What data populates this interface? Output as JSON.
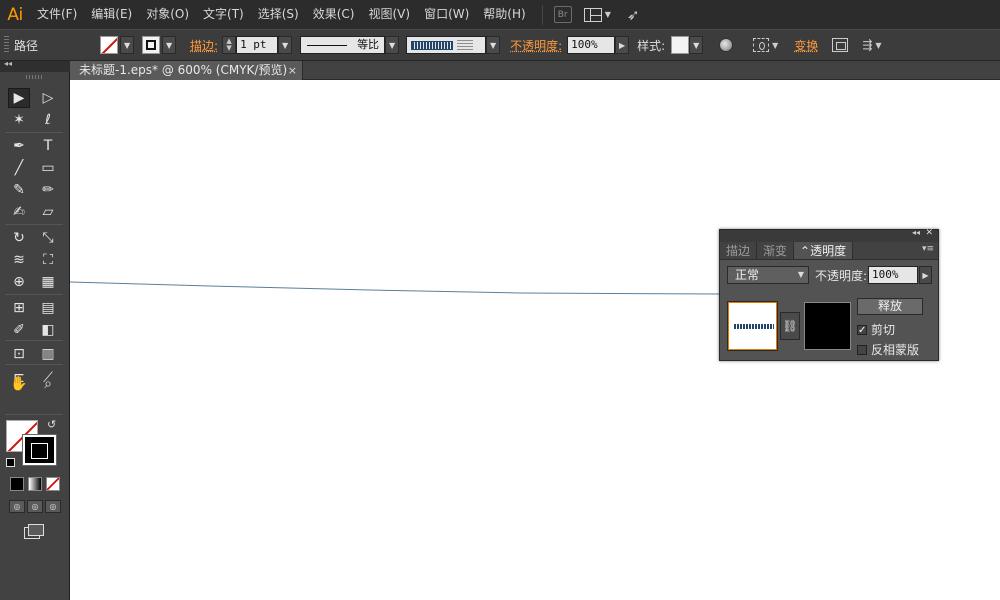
{
  "app": {
    "logo": "Ai"
  },
  "menu": [
    "文件(F)",
    "编辑(E)",
    "对象(O)",
    "文字(T)",
    "选择(S)",
    "效果(C)",
    "视图(V)",
    "窗口(W)",
    "帮助(H)"
  ],
  "menubar_extra": {
    "bridge_label": "Br"
  },
  "control": {
    "selection_label": "路径",
    "stroke_label": "描边:",
    "stroke_weight": "1 pt",
    "stroke_profile": "等比",
    "opacity_label": "不透明度:",
    "opacity_value": "100%",
    "style_label": "样式:",
    "transform_label": "变换"
  },
  "document_tab": {
    "title": "未标题-1.eps* @ 600% (CMYK/预览)",
    "close": "×"
  },
  "toolbox": {
    "tools": [
      {
        "name": "selection-tool",
        "glyph": "▶"
      },
      {
        "name": "direct-selection-tool",
        "glyph": "▷"
      },
      {
        "name": "magic-wand-tool",
        "glyph": "✶"
      },
      {
        "name": "lasso-tool",
        "glyph": "ℓ"
      },
      {
        "name": "pen-tool",
        "glyph": "✒"
      },
      {
        "name": "type-tool",
        "glyph": "T"
      },
      {
        "name": "line-segment-tool",
        "glyph": "╱"
      },
      {
        "name": "rectangle-tool",
        "glyph": "▭"
      },
      {
        "name": "paintbrush-tool",
        "glyph": "✎"
      },
      {
        "name": "pencil-tool",
        "glyph": "✏"
      },
      {
        "name": "blob-brush-tool",
        "glyph": "✍"
      },
      {
        "name": "eraser-tool",
        "glyph": "▱"
      },
      {
        "name": "rotate-tool",
        "glyph": "↻"
      },
      {
        "name": "scale-tool",
        "glyph": "⤡"
      },
      {
        "name": "warp-tool",
        "glyph": "≋"
      },
      {
        "name": "free-transform-tool",
        "glyph": "⛶"
      },
      {
        "name": "shape-builder-tool",
        "glyph": "⊕"
      },
      {
        "name": "perspective-grid-tool",
        "glyph": "▦"
      },
      {
        "name": "mesh-tool",
        "glyph": "⊞"
      },
      {
        "name": "gradient-tool",
        "glyph": "▤"
      },
      {
        "name": "eyedropper-tool",
        "glyph": "✐"
      },
      {
        "name": "blend-tool",
        "glyph": "◧"
      },
      {
        "name": "symbol-sprayer-tool",
        "glyph": "⊡"
      },
      {
        "name": "column-graph-tool",
        "glyph": "▥"
      },
      {
        "name": "artboard-tool",
        "glyph": "⊏"
      },
      {
        "name": "slice-tool",
        "glyph": "⟋"
      },
      {
        "name": "hand-tool",
        "glyph": "✋"
      },
      {
        "name": "zoom-tool",
        "glyph": "⌕"
      }
    ]
  },
  "transparency_panel": {
    "tabs": [
      "描边",
      "渐变",
      "⌃透明度"
    ],
    "blend_mode": "正常",
    "opacity_label": "不透明度:",
    "opacity_value": "100%",
    "release_button": "释放",
    "clip_label": "剪切",
    "clip_checked": "✓",
    "invert_label": "反相蒙版"
  },
  "colors": {
    "accent_orange": "#ff9a00",
    "path_stroke": "#5a7f9a"
  }
}
